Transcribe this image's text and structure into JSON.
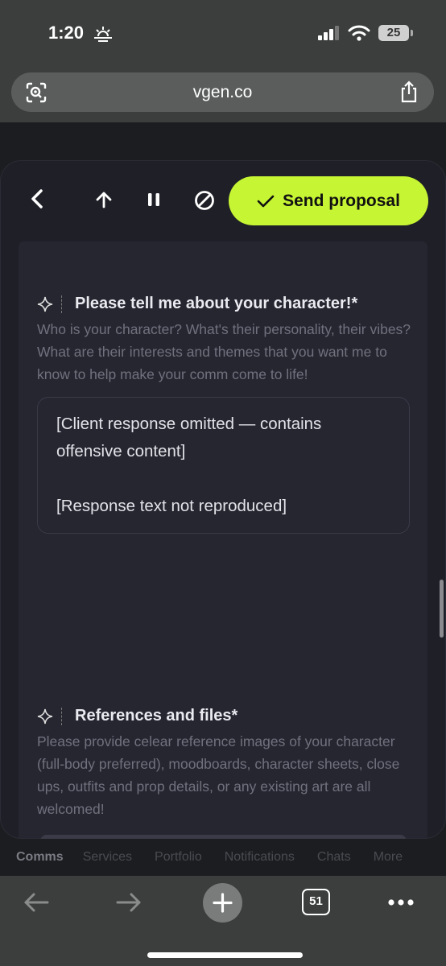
{
  "status_bar": {
    "time": "1:20",
    "battery": "25"
  },
  "url_bar": {
    "url": "vgen.co"
  },
  "toolbar": {
    "send_label": "Send proposal"
  },
  "questions": [
    {
      "title": "Please tell me about your character!*",
      "description": "Who is your character? What's their personality, their vibes? What are their interests and themes that you want me to know to help make your comm come to life!",
      "answer_paragraphs": [
        "[Client response omitted — contains offensive content]",
        "[Response text not reproduced]"
      ]
    },
    {
      "title": "References and files*",
      "description": "Please provide celear reference images of your character (full-body preferred), moodboards, character sheets, close ups, outfits and prop details, or any existing art are all welcomed!"
    }
  ],
  "bottom_tabs": [
    "Comms",
    "Services",
    "Portfolio",
    "Notifications",
    "Chats",
    "More"
  ],
  "browser_nav": {
    "tab_count": "51"
  },
  "colors": {
    "accent": "#c6f533",
    "modal_bg": "#1e1f27",
    "chrome": "#3b3e3d"
  },
  "icons": [
    "sun-icon",
    "signal-icon",
    "wifi-icon",
    "lens-icon",
    "share-icon",
    "back-icon",
    "up-arrow-icon",
    "pause-icon",
    "block-icon",
    "check-icon",
    "sparkle-icon",
    "plus-icon",
    "more-icon"
  ]
}
